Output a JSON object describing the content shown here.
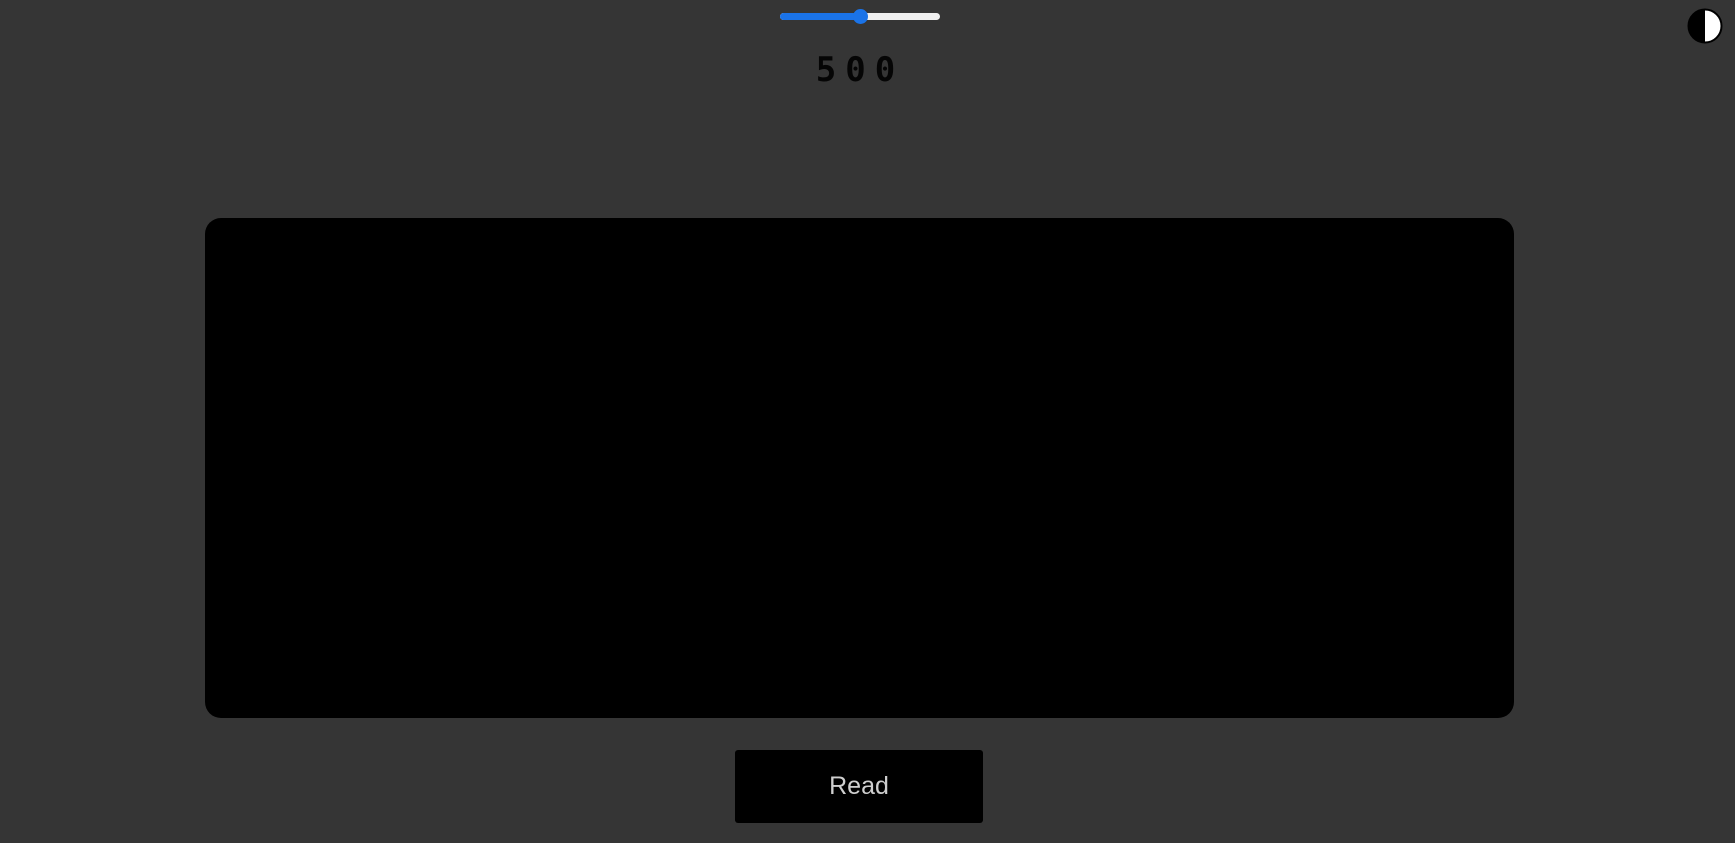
{
  "speed": {
    "value": "500",
    "slider_fraction": 0.5
  },
  "theme_toggle": {
    "icon": "contrast-icon"
  },
  "reader": {
    "text": ""
  },
  "controls": {
    "read_label": "Read"
  },
  "colors": {
    "background": "#353535",
    "accent": "#1a73e8",
    "display": "#000000",
    "button_text": "#cfcfcf"
  }
}
